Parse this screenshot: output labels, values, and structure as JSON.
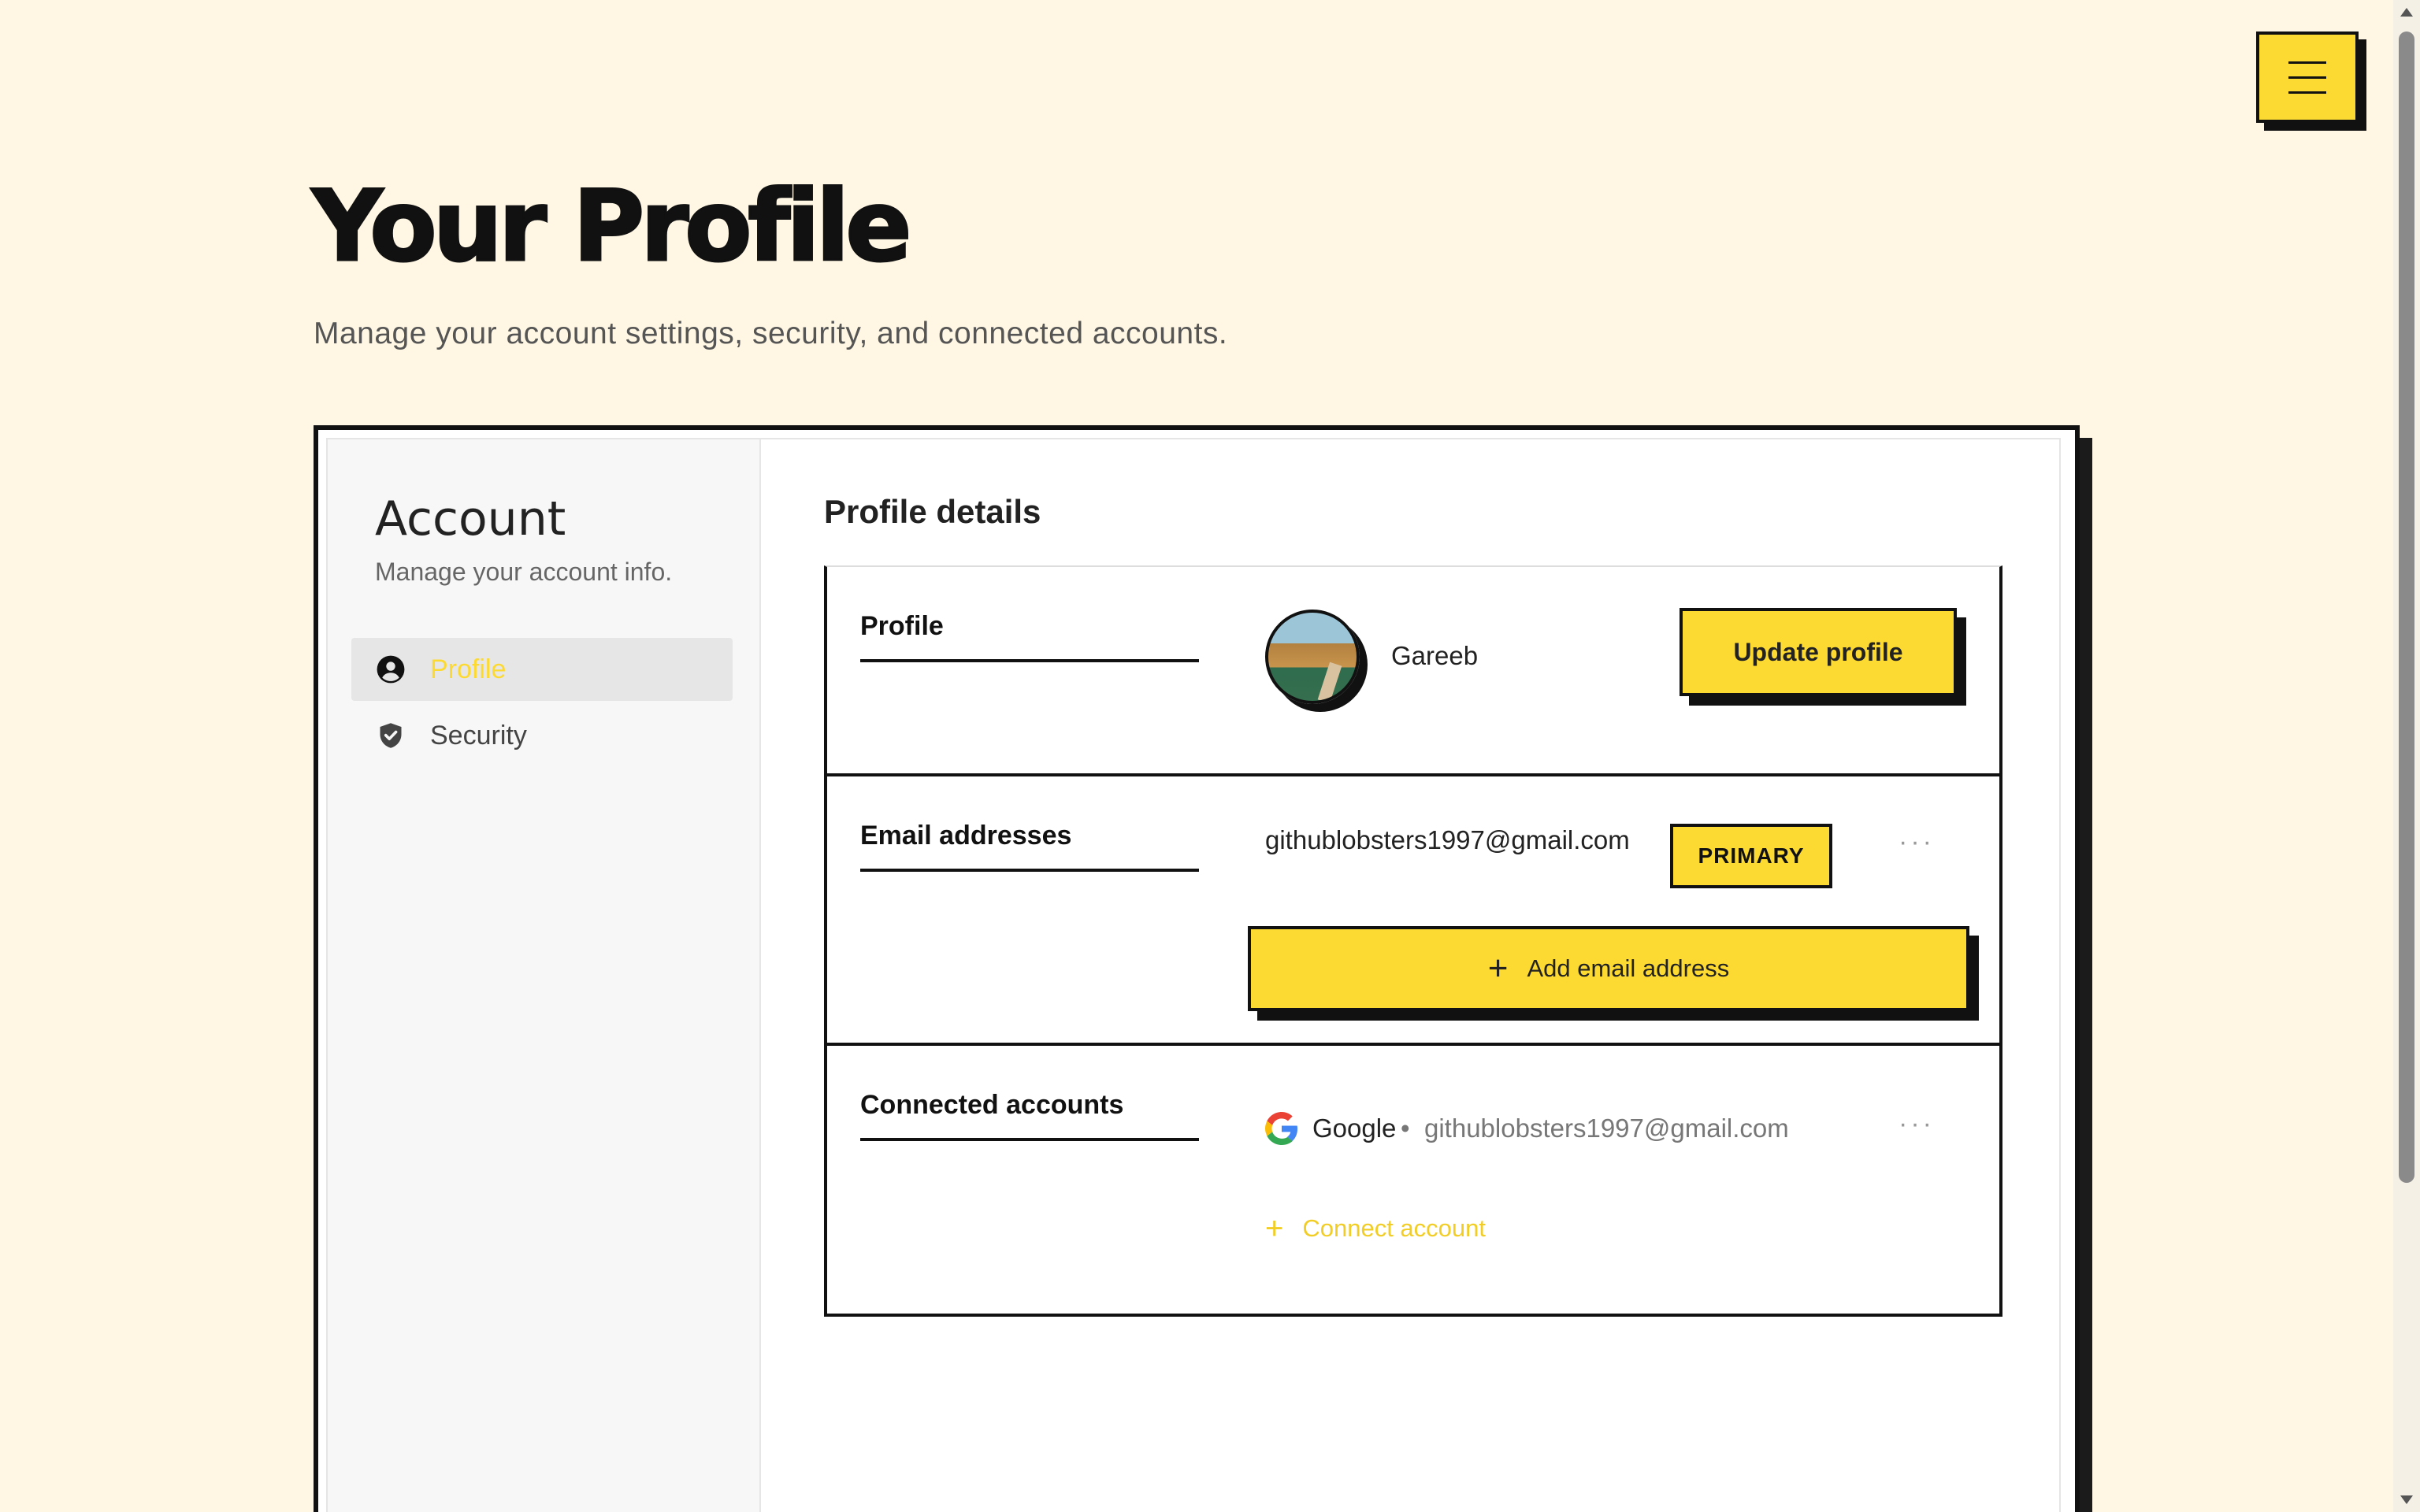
{
  "page": {
    "title": "Your Profile",
    "subtitle": "Manage your account settings, security, and connected accounts."
  },
  "sidebar": {
    "title": "Account",
    "subtitle": "Manage your account info.",
    "items": [
      {
        "label": "Profile",
        "icon": "user-circle-icon",
        "active": true
      },
      {
        "label": "Security",
        "icon": "shield-check-icon",
        "active": false
      }
    ]
  },
  "content": {
    "title": "Profile details",
    "profile": {
      "label": "Profile",
      "name": "Gareeb",
      "update_button": "Update profile"
    },
    "email": {
      "label": "Email addresses",
      "address": "githublobsters1997@gmail.com",
      "badge": "PRIMARY",
      "menu": "···",
      "add_button": "Add email address",
      "add_icon": "+"
    },
    "connected": {
      "label": "Connected accounts",
      "provider": "Google",
      "separator": "•",
      "email": "githublobsters1997@gmail.com",
      "menu": "···",
      "connect_label": "Connect account",
      "connect_icon": "+"
    }
  },
  "colors": {
    "background": "#fff7e3",
    "accent": "#fdda32",
    "ink": "#111111"
  }
}
